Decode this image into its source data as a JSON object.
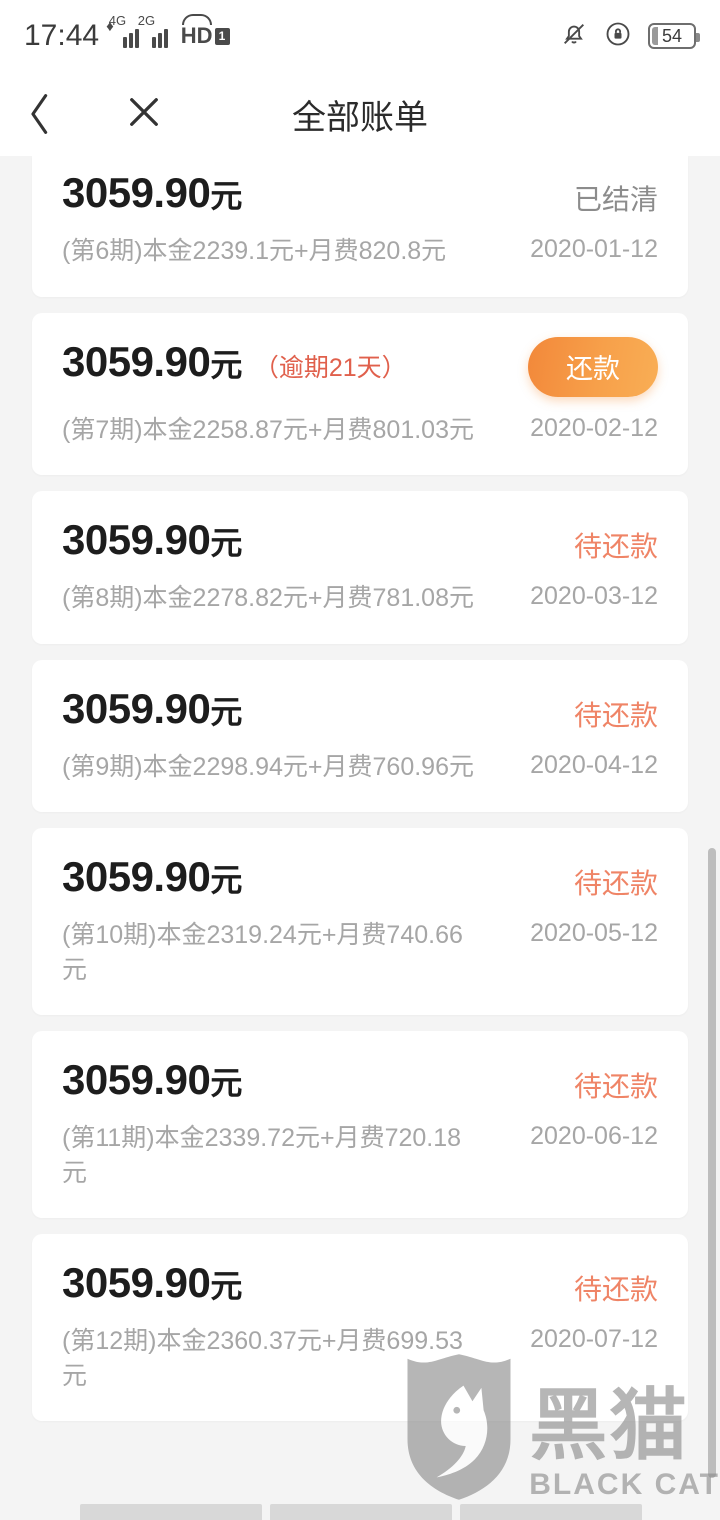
{
  "status_bar": {
    "time": "17:44",
    "network_1": "4G",
    "network_2": "2G",
    "volte_label": "HD",
    "volte_badge": "1",
    "battery_level": "54",
    "icons": [
      "bell-muted-icon",
      "rotation-lock-icon",
      "battery-icon"
    ]
  },
  "header": {
    "title": "全部账单",
    "back_icon": "chevron-left-icon",
    "close_icon": "close-icon"
  },
  "colors": {
    "accent_orange": "#ef8466",
    "button_gradient_start": "#f2883a",
    "button_gradient_end": "#f9ae55",
    "overdue_red": "#e0604c",
    "settled_gray": "#8c8c8c",
    "muted_text": "#a6a6a6",
    "page_background": "#f4f4f4",
    "card_background": "#ffffff"
  },
  "bills": [
    {
      "amount": "3059.90",
      "unit": "元",
      "overdue": "",
      "status": "已结清",
      "status_kind": "settled",
      "action_label": "",
      "description": "(第6期)本金2239.1元+月费820.8元",
      "date": "2020-01-12"
    },
    {
      "amount": "3059.90",
      "unit": "元",
      "overdue": "（逾期21天）",
      "status": "",
      "status_kind": "action",
      "action_label": "还款",
      "description": "(第7期)本金2258.87元+月费801.03元",
      "date": "2020-02-12"
    },
    {
      "amount": "3059.90",
      "unit": "元",
      "overdue": "",
      "status": "待还款",
      "status_kind": "pending",
      "action_label": "",
      "description": "(第8期)本金2278.82元+月费781.08元",
      "date": "2020-03-12"
    },
    {
      "amount": "3059.90",
      "unit": "元",
      "overdue": "",
      "status": "待还款",
      "status_kind": "pending",
      "action_label": "",
      "description": "(第9期)本金2298.94元+月费760.96元",
      "date": "2020-04-12"
    },
    {
      "amount": "3059.90",
      "unit": "元",
      "overdue": "",
      "status": "待还款",
      "status_kind": "pending",
      "action_label": "",
      "description": "(第10期)本金2319.24元+月费740.66元",
      "date": "2020-05-12"
    },
    {
      "amount": "3059.90",
      "unit": "元",
      "overdue": "",
      "status": "待还款",
      "status_kind": "pending",
      "action_label": "",
      "description": "(第11期)本金2339.72元+月费720.18元",
      "date": "2020-06-12"
    },
    {
      "amount": "3059.90",
      "unit": "元",
      "overdue": "",
      "status": "待还款",
      "status_kind": "pending",
      "action_label": "",
      "description": "(第12期)本金2360.37元+月费699.53元",
      "date": "2020-07-12"
    }
  ],
  "watermark": {
    "chinese": "黑猫",
    "english": "BLACK CAT",
    "icon": "cat-shield-icon"
  }
}
